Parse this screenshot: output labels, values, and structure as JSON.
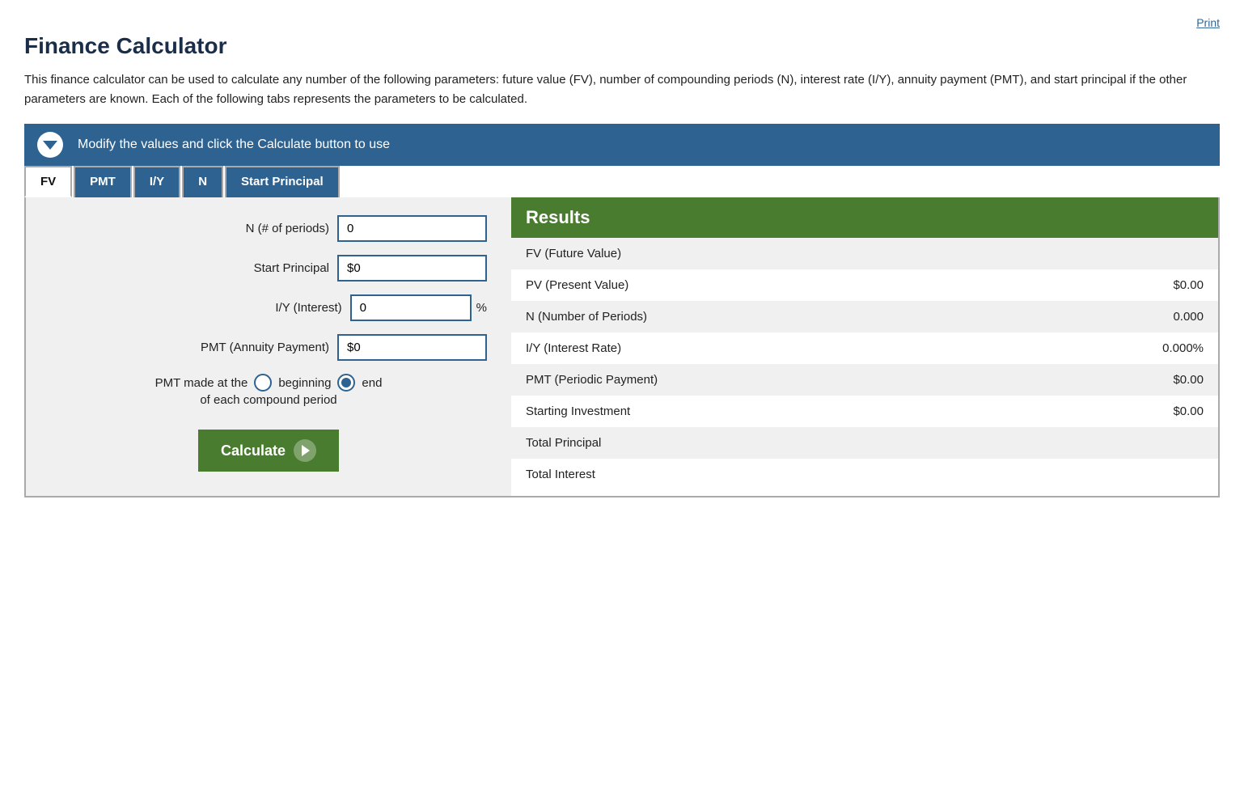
{
  "print_link": "Print",
  "page_title": "Finance Calculator",
  "description": "This finance calculator can be used to calculate any number of the following parameters: future value (FV), number of compounding periods (N), interest rate (I/Y), annuity payment (PMT), and start principal if the other parameters are known. Each of the following tabs represents the parameters to be calculated.",
  "instruction_bar": {
    "text": "Modify the values and click the Calculate button to use"
  },
  "tabs": [
    {
      "id": "fv",
      "label": "FV",
      "active": true
    },
    {
      "id": "pmt",
      "label": "PMT",
      "active": false
    },
    {
      "id": "iy",
      "label": "I/Y",
      "active": false
    },
    {
      "id": "n",
      "label": "N",
      "active": false
    },
    {
      "id": "start-principal",
      "label": "Start Principal",
      "active": false
    }
  ],
  "form": {
    "fields": [
      {
        "id": "n-periods",
        "label": "N (# of periods)",
        "value": "0",
        "prefix": "",
        "suffix": ""
      },
      {
        "id": "start-principal",
        "label": "Start Principal",
        "value": "$0",
        "prefix": "",
        "suffix": ""
      },
      {
        "id": "iy-interest",
        "label": "I/Y (Interest)",
        "value": "0",
        "prefix": "",
        "suffix": "%"
      },
      {
        "id": "pmt-payment",
        "label": "PMT (Annuity Payment)",
        "value": "$0",
        "prefix": "",
        "suffix": ""
      }
    ],
    "pmt_timing_label": "PMT made at the",
    "pmt_beginning": "beginning",
    "pmt_end": "end",
    "pmt_subtext": "of each compound period",
    "calculate_button": "Calculate"
  },
  "results": {
    "header": "Results",
    "rows": [
      {
        "label": "FV (Future Value)",
        "value": ""
      },
      {
        "label": "PV (Present Value)",
        "value": "$0.00"
      },
      {
        "label": "N (Number of Periods)",
        "value": "0.000"
      },
      {
        "label": "I/Y (Interest Rate)",
        "value": "0.000%"
      },
      {
        "label": "PMT (Periodic Payment)",
        "value": "$0.00"
      },
      {
        "label": "Starting Investment",
        "value": "$0.00"
      },
      {
        "label": "Total Principal",
        "value": ""
      },
      {
        "label": "Total Interest",
        "value": ""
      }
    ]
  }
}
